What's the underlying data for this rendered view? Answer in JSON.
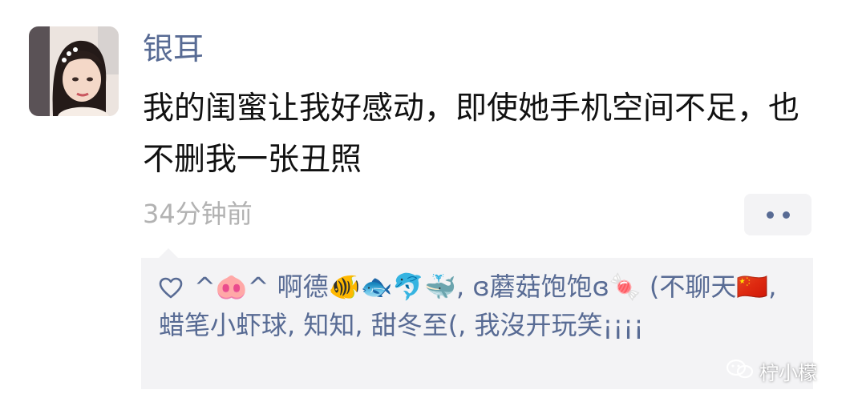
{
  "user": {
    "name": "银耳"
  },
  "post": {
    "text": "我的闺蜜让我好感动，即使她手机空间不足，也不删我一张丑照",
    "time": "34分钟前"
  },
  "likes": {
    "text": "^🐽^ 啊德🐠🐟🐬🐳, ɞ蘑菇饱饱ɞ🍬 (不聊天🇨🇳, 蜡笔小虾球, 知知, 甜冬至(, 我沒开玩笑¡¡¡¡"
  },
  "watermark": {
    "text": "柠小檬"
  },
  "icons": {
    "like": "heart-outline-icon",
    "more": "more-dots-icon",
    "watermark": "wechat-icon"
  },
  "colors": {
    "link": "#586b94",
    "time": "#b2b2b2",
    "panel": "#f3f3f5",
    "text": "#111111"
  }
}
